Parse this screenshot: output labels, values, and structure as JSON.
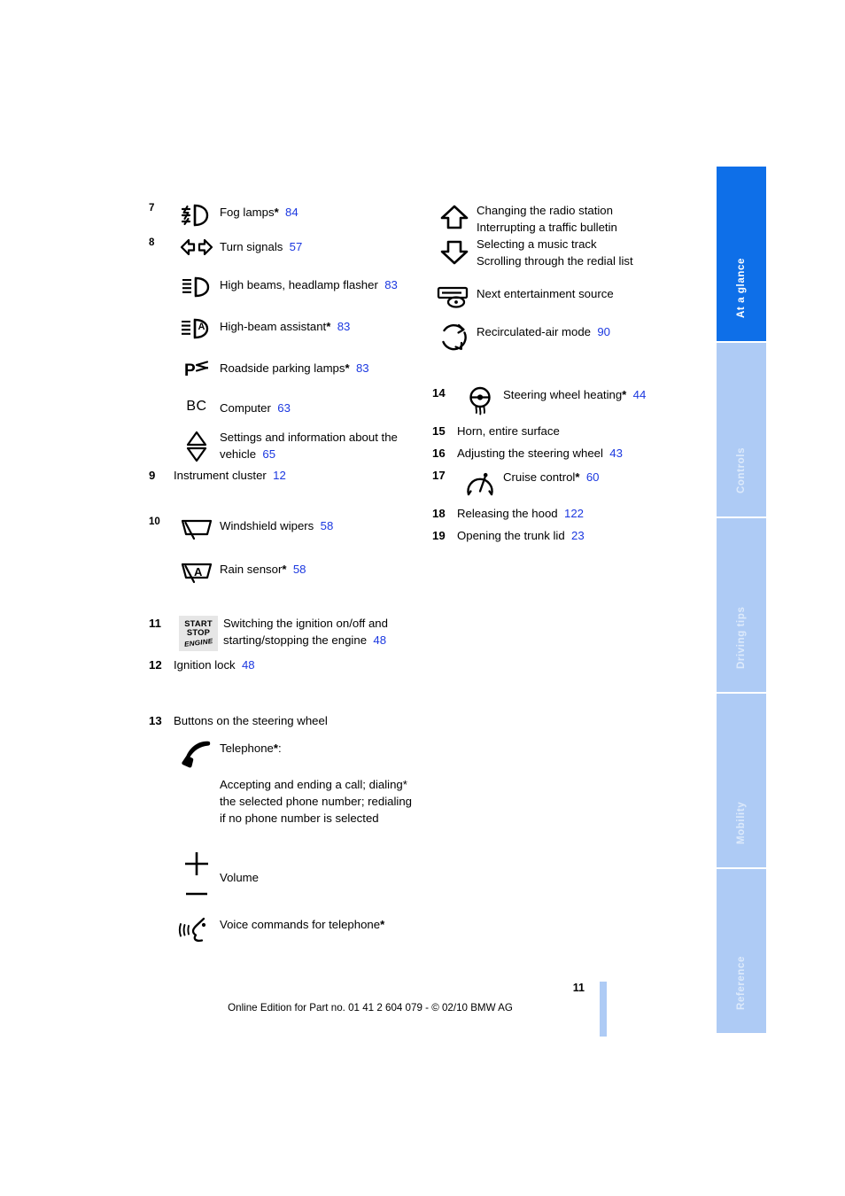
{
  "document": {
    "page_number": "11",
    "footer_note": "Online Edition for Part no. 01 41 2 604 079 - © 02/10 BMW AG",
    "accent_blue": "#1b38e0",
    "tab_active_color": "#0e6fe8",
    "tab_inactive_color": "#aecbf5"
  },
  "tabs": [
    {
      "label": "At a glance",
      "active": true
    },
    {
      "label": "Controls",
      "active": false
    },
    {
      "label": "Driving tips",
      "active": false
    },
    {
      "label": "Mobility",
      "active": false
    },
    {
      "label": "Reference",
      "active": false
    }
  ],
  "left_column": {
    "item7": {
      "number": "7",
      "icon": "fog-lamps-icon",
      "label": "Fog lamps",
      "star": "*",
      "page": "84"
    },
    "item8": {
      "number": "8",
      "entries": [
        {
          "icon": "turn-signals-icon",
          "label": "Turn signals",
          "star": "",
          "page": "57"
        },
        {
          "icon": "high-beams-icon",
          "label": "High beams, headlamp flasher",
          "star": "",
          "page": "83"
        },
        {
          "icon": "high-beam-assistant-icon",
          "label": "High-beam assistant",
          "star": "*",
          "page": "83"
        },
        {
          "icon": "roadside-parking-lamps-icon",
          "label": "Roadside parking lamps",
          "star": "*",
          "page": "83"
        },
        {
          "icon": "computer-bc-icon",
          "label": "Computer",
          "star": "",
          "page": "63"
        },
        {
          "icon": "settings-up-down-icon",
          "label": "Settings and information about the vehicle",
          "star": "",
          "page": "65"
        }
      ]
    },
    "item9": {
      "number": "9",
      "label": "Instrument cluster",
      "page": "12"
    },
    "item10": {
      "number": "10",
      "entries": [
        {
          "icon": "windshield-wiper-icon",
          "label": "Windshield wipers",
          "star": "",
          "page": "58"
        },
        {
          "icon": "rain-sensor-icon",
          "label": "Rain sensor",
          "star": "*",
          "page": "58"
        }
      ]
    },
    "item11": {
      "number": "11",
      "icon": "start-stop-engine-icon",
      "icon_text": {
        "line1": "START",
        "line2": "STOP",
        "line3": "ENGINE"
      },
      "label": "Switching the ignition on/off and starting/stopping the engine",
      "page": "48"
    },
    "item12": {
      "number": "12",
      "label": "Ignition lock",
      "page": "48"
    },
    "item13": {
      "number": "13",
      "label": "Buttons on the steering wheel",
      "entries": [
        {
          "icon": "telephone-handset-icon",
          "title": "Telephone",
          "star": "*",
          "title_suffix": ":",
          "body": "Accepting and ending a call; dialing* the selected phone number; redialing if no phone number is selected"
        },
        {
          "icon": "volume-plus-minus-icon",
          "label": "Volume",
          "star": "",
          "page": ""
        },
        {
          "icon": "voice-command-icon",
          "label": "Voice commands for telephone",
          "star": "*",
          "page": ""
        }
      ]
    }
  },
  "right_column": {
    "arrows_group": {
      "icon_up": "arrow-up-icon",
      "icon_down": "arrow-down-icon",
      "lines": [
        "Changing the radio station",
        "Interrupting a traffic bulletin",
        "Selecting a music track",
        "Scrolling through the redial list"
      ]
    },
    "entertainment": {
      "icon": "entertainment-source-icon",
      "label": "Next entertainment source",
      "page": ""
    },
    "recirculated_air": {
      "icon": "recirculated-air-icon",
      "label": "Recirculated-air mode",
      "page": "90"
    },
    "item14": {
      "number": "14",
      "icon": "steering-wheel-heating-icon",
      "label": "Steering wheel heating",
      "star": "*",
      "page": "44"
    },
    "item15": {
      "number": "15",
      "label": "Horn, entire surface",
      "page": ""
    },
    "item16": {
      "number": "16",
      "label": "Adjusting the steering wheel",
      "page": "43"
    },
    "item17": {
      "number": "17",
      "icon": "cruise-control-icon",
      "label": "Cruise control",
      "star": "*",
      "page": "60"
    },
    "item18": {
      "number": "18",
      "label": "Releasing the hood",
      "page": "122"
    },
    "item19": {
      "number": "19",
      "label": "Opening the trunk lid",
      "page": "23"
    }
  }
}
